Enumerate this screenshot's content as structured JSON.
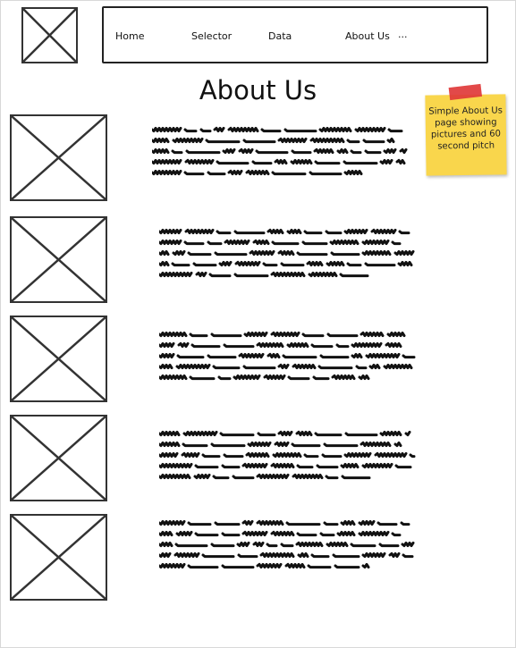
{
  "nav": {
    "items": [
      {
        "label": "Home"
      },
      {
        "label": "Selector"
      },
      {
        "label": "Data"
      },
      {
        "label": "About Us"
      },
      {
        "label": "..."
      }
    ]
  },
  "page": {
    "title": "About Us"
  },
  "sticky_note": {
    "text": "Simple About Us page showing pictures and 60 second pitch"
  },
  "sections": [
    {
      "image": "image-placeholder"
    },
    {
      "image": "image-placeholder"
    },
    {
      "image": "image-placeholder"
    },
    {
      "image": "image-placeholder"
    },
    {
      "image": "image-placeholder"
    }
  ],
  "icons": {
    "logo": "image-placeholder-icon",
    "sticky_tape": "tape-icon"
  },
  "colors": {
    "sticky": "#f9d64c",
    "tape": "#e0393a",
    "ink": "#111111"
  }
}
